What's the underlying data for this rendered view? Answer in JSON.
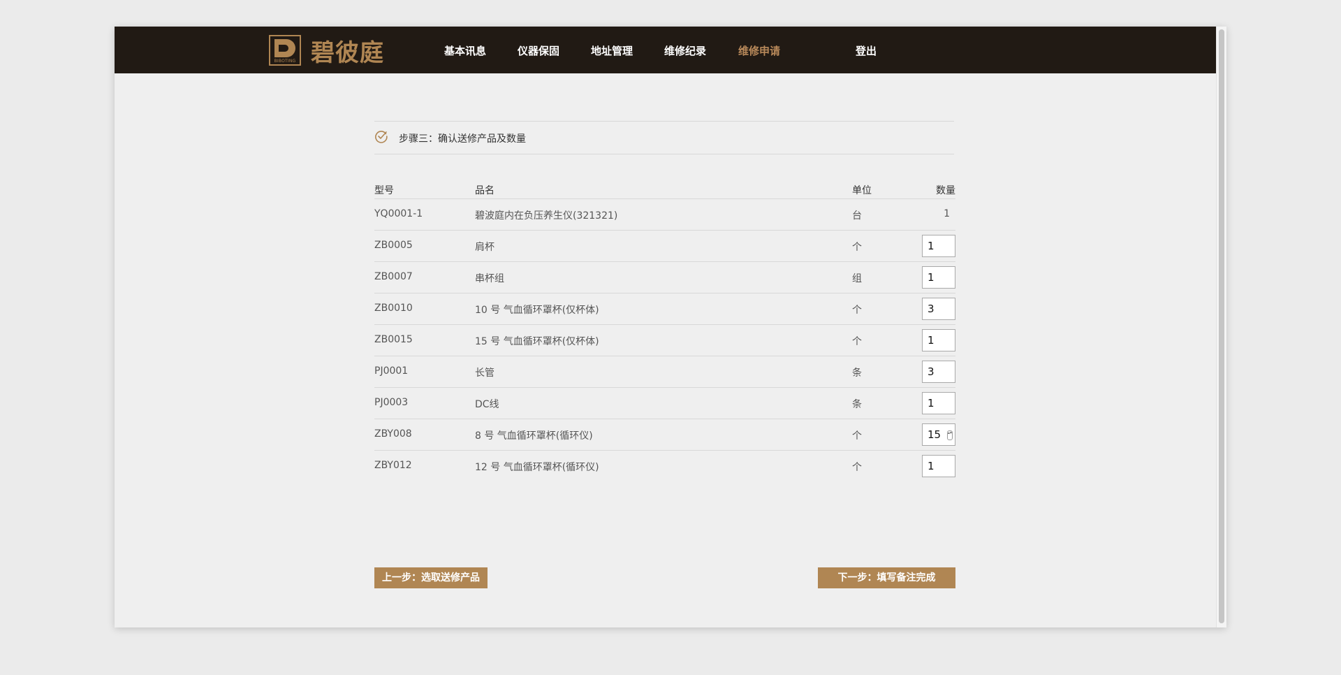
{
  "brand": {
    "name": "碧彼庭",
    "logo_sub": "BIBOTING"
  },
  "nav": {
    "items": [
      {
        "label": "基本讯息",
        "active": false
      },
      {
        "label": "仪器保固",
        "active": false
      },
      {
        "label": "地址管理",
        "active": false
      },
      {
        "label": "维修纪录",
        "active": false
      },
      {
        "label": "维修申请",
        "active": true
      },
      {
        "label": "登出",
        "active": false
      }
    ]
  },
  "step": {
    "label": "步骤三：确认送修产品及数量"
  },
  "table": {
    "headers": {
      "model": "型号",
      "name": "品名",
      "unit": "单位",
      "qty": "数量"
    },
    "rows": [
      {
        "model": "YQ0001-1",
        "name": "碧波庭内在负压养生仪(321321)",
        "unit": "台",
        "qty": "1",
        "editable": false
      },
      {
        "model": "ZB0005",
        "name": "肩杯",
        "unit": "个",
        "qty": "1",
        "editable": true
      },
      {
        "model": "ZB0007",
        "name": "串杯组",
        "unit": "组",
        "qty": "1",
        "editable": true
      },
      {
        "model": "ZB0010",
        "name": "10 号 气血循环罩杯(仅杯体)",
        "unit": "个",
        "qty": "3",
        "editable": true
      },
      {
        "model": "ZB0015",
        "name": "15 号 气血循环罩杯(仅杯体)",
        "unit": "个",
        "qty": "1",
        "editable": true
      },
      {
        "model": "PJ0001",
        "name": "长管",
        "unit": "条",
        "qty": "3",
        "editable": true
      },
      {
        "model": "PJ0003",
        "name": "DC线",
        "unit": "条",
        "qty": "1",
        "editable": true
      },
      {
        "model": "ZBY008",
        "name": "8 号 气血循环罩杯(循环仪)",
        "unit": "个",
        "qty": "15",
        "editable": true
      },
      {
        "model": "ZBY012",
        "name": "12 号 气血循环罩杯(循环仪)",
        "unit": "个",
        "qty": "1",
        "editable": true
      }
    ]
  },
  "buttons": {
    "prev": "上一步：选取送修产品",
    "next": "下一步：填写备注完成"
  },
  "colors": {
    "navbar": "#211a14",
    "accent": "#b08653",
    "active_nav": "#b8895a"
  }
}
